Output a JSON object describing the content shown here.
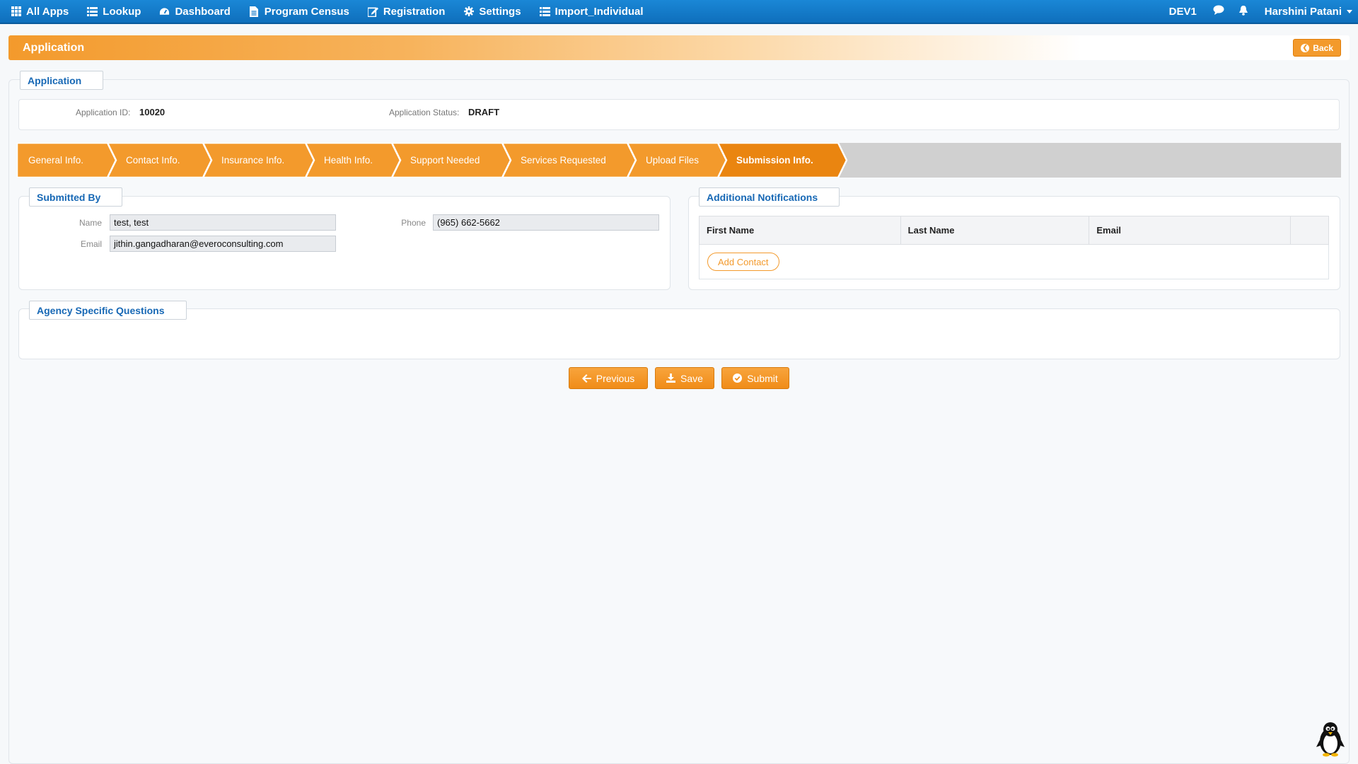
{
  "nav": {
    "items": [
      {
        "label": "All Apps",
        "icon": "grid-icon"
      },
      {
        "label": "Lookup",
        "icon": "list-icon"
      },
      {
        "label": "Dashboard",
        "icon": "dashboard-icon"
      },
      {
        "label": "Program Census",
        "icon": "document-icon"
      },
      {
        "label": "Registration",
        "icon": "edit-icon"
      },
      {
        "label": "Settings",
        "icon": "gear-icon"
      },
      {
        "label": "Import_Individual",
        "icon": "list-icon"
      }
    ],
    "env": "DEV1",
    "user": "Harshini Patani"
  },
  "banner": {
    "title": "Application",
    "back_label": "Back"
  },
  "application": {
    "legend": "Application",
    "id_label": "Application ID:",
    "id_value": "10020",
    "status_label": "Application Status:",
    "status_value": "DRAFT"
  },
  "steps": [
    {
      "label": "General Info.",
      "active": false
    },
    {
      "label": "Contact Info.",
      "active": false
    },
    {
      "label": "Insurance Info.",
      "active": false
    },
    {
      "label": "Health Info.",
      "active": false
    },
    {
      "label": "Support Needed",
      "active": false
    },
    {
      "label": "Services Requested",
      "active": false
    },
    {
      "label": "Upload Files",
      "active": false
    },
    {
      "label": "Submission Info.",
      "active": true
    }
  ],
  "submitted_by": {
    "legend": "Submitted By",
    "name_label": "Name",
    "name_value": "test, test",
    "email_label": "Email",
    "email_value": "jithin.gangadharan@everoconsulting.com",
    "phone_label": "Phone",
    "phone_value": "(965) 662-5662"
  },
  "notifications": {
    "legend": "Additional Notifications",
    "columns": [
      "First Name",
      "Last Name",
      "Email",
      ""
    ],
    "add_label": "Add Contact"
  },
  "agency": {
    "legend": "Agency Specific Questions"
  },
  "actions": {
    "previous": "Previous",
    "save": "Save",
    "submit": "Submit"
  },
  "colors": {
    "nav_blue": "#1a87d6",
    "accent_orange": "#f39a2c",
    "active_step": "#ea8510",
    "legend_blue": "#1768b5"
  }
}
